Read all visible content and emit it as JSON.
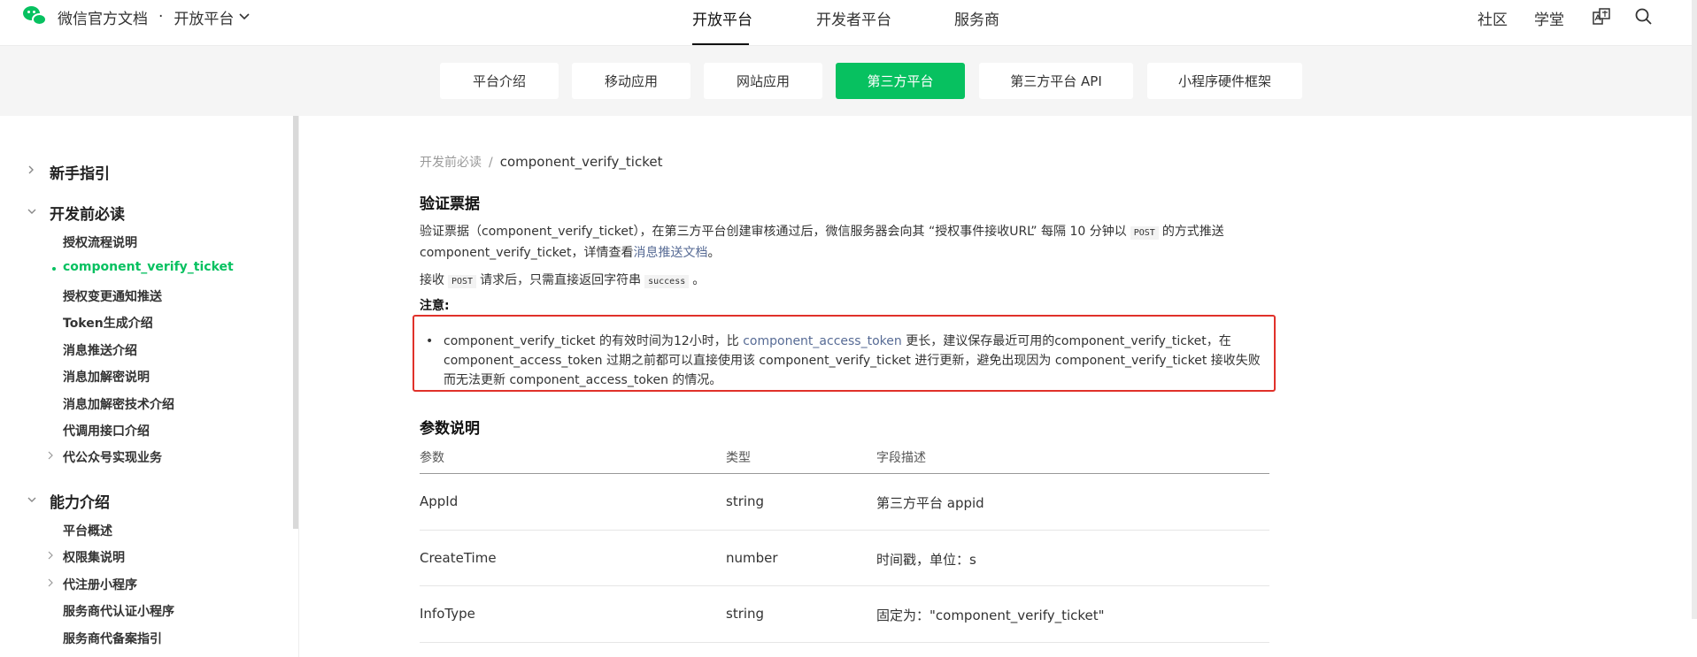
{
  "header": {
    "brand": "微信官方文档",
    "dot": "·",
    "platform_switch": "开放平台",
    "nav": [
      "开放平台",
      "开发者平台",
      "服务商"
    ],
    "right_links": [
      "社区",
      "学堂"
    ],
    "icons": [
      "wechat-logo-icon",
      "chevron-down-icon",
      "translate-icon",
      "search-icon"
    ]
  },
  "subnav": [
    "平台介绍",
    "移动应用",
    "网站应用",
    "第三方平台",
    "第三方平台 API",
    "小程序硬件框架"
  ],
  "sidebar": {
    "sections": [
      {
        "label": "新手指引"
      },
      {
        "label": "开发前必读"
      },
      {
        "label": "能力介绍"
      }
    ],
    "items": [
      "授权流程说明",
      "component_verify_ticket",
      "授权变更通知推送",
      "Token生成介绍",
      "消息推送介绍",
      "消息加解密说明",
      "消息加解密技术介绍",
      "代调用接口介绍",
      "代公众号实现业务",
      "平台概述",
      "权限集说明",
      "代注册小程序",
      "服务商代认证小程序",
      "服务商代备案指引"
    ]
  },
  "content": {
    "breadcrumb": [
      "开发前必读",
      "/",
      "component_verify_ticket"
    ],
    "title": "验证票据",
    "para1_a": "验证票据（component_verify_ticket），在第三方平台创建审核通过后，微信服务器会向其 “授权事件接收URL” 每隔 10 分钟以",
    "para1_code": "POST",
    "para1_b": "的方式推送",
    "para1_c": "component_verify_ticket，详情查看",
    "para1_link": "消息推送文档",
    "para1_d": "。",
    "para2_a": "接收",
    "para2_code1": "POST",
    "para2_b": "请求后，只需直接返回字符串",
    "para2_code2": "success",
    "para2_c": "。",
    "note_label": "注意:",
    "note_a": "component_verify_ticket 的有效时间为12小时，比",
    "note_link": "component_access_token",
    "note_b": "更长，建议保存最近可用的component_verify_ticket，在 component_access_token 过期之前都可以直接使用该 component_verify_ticket 进行更新，避免出现因为 component_verify_ticket 接收失败而无法更新 component_access_token 的情况。",
    "params_title": "参数说明",
    "table": {
      "headers": [
        "参数",
        "类型",
        "字段描述"
      ],
      "rows": [
        [
          "AppId",
          "string",
          "第三方平台 appid"
        ],
        [
          "CreateTime",
          "number",
          "时间戳，单位：s"
        ],
        [
          "InfoType",
          "string",
          "固定为：\"component_verify_ticket\""
        ]
      ]
    }
  }
}
